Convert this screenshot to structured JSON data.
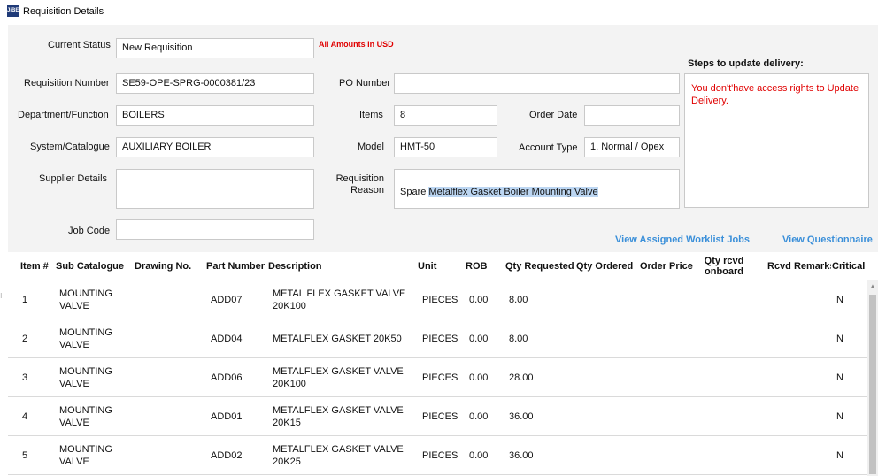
{
  "window": {
    "title": "Requisition Details",
    "icon_label": "JiBE"
  },
  "labels": {
    "current_status": "Current Status",
    "requisition_number": "Requisition Number",
    "department": "Department/Function",
    "system": "System/Catalogue",
    "supplier": "Supplier Details",
    "job_code": "Job Code",
    "po_number": "PO Number",
    "items": "Items",
    "model": "Model",
    "reason_line1": "Requisition",
    "reason_line2": "Reason",
    "order_date": "Order Date",
    "account_type": "Account Type"
  },
  "values": {
    "current_status": "New Requisition",
    "requisition_number": "SE59-OPE-SPRG-0000381/23",
    "department": "BOILERS",
    "system": "AUXILIARY BOILER",
    "supplier": "",
    "job_code": "",
    "po_number": "",
    "items": "8",
    "model": "HMT-50",
    "reason_prefix": "Spare ",
    "reason_highlight": "Metalflex Gasket Boiler Mounting Valve",
    "order_date": "",
    "account_type": "1. Normal / Opex"
  },
  "amounts_note": "All Amounts in USD",
  "steps": {
    "title": "Steps to update delivery:",
    "message": "You don't'have access rights to Update Delivery."
  },
  "links": {
    "worklist": "View Assigned Worklist Jobs",
    "questionnaire": "View Questionnaire"
  },
  "table": {
    "headers": {
      "item": "Item #",
      "sub_catalogue": "Sub Catalogue",
      "drawing": "Drawing No.",
      "part": "Part Number",
      "description": "Description",
      "unit": "Unit",
      "rob": "ROB",
      "qty_requested": "Qty Requested",
      "qty_ordered": "Qty Ordered",
      "order_price": "Order Price",
      "qty_rcvd_1": "Qty rcvd",
      "qty_rcvd_2": "onboard",
      "rcvd_remarks": "Rcvd Remarks",
      "critical": "Critical"
    },
    "rows": [
      {
        "item": "1",
        "sub1": "MOUNTING",
        "sub2": "VALVE",
        "drawing": "",
        "part": "ADD07",
        "desc1": "METAL FLEX GASKET VALVE",
        "desc2": "20K100",
        "unit": "PIECES",
        "rob": "0.00",
        "qty_requested": "8.00",
        "qty_ordered": "",
        "order_price": "",
        "qty_rcvd": "",
        "remarks": "",
        "critical": "N"
      },
      {
        "item": "2",
        "sub1": "MOUNTING",
        "sub2": "VALVE",
        "drawing": "",
        "part": "ADD04",
        "desc1": "METALFLEX GASKET 20K50",
        "desc2": "",
        "unit": "PIECES",
        "rob": "0.00",
        "qty_requested": "8.00",
        "qty_ordered": "",
        "order_price": "",
        "qty_rcvd": "",
        "remarks": "",
        "critical": "N"
      },
      {
        "item": "3",
        "sub1": "MOUNTING",
        "sub2": "VALVE",
        "drawing": "",
        "part": "ADD06",
        "desc1": "METALFLEX GASKET VALVE",
        "desc2": "20K100",
        "unit": "PIECES",
        "rob": "0.00",
        "qty_requested": "28.00",
        "qty_ordered": "",
        "order_price": "",
        "qty_rcvd": "",
        "remarks": "",
        "critical": "N"
      },
      {
        "item": "4",
        "sub1": "MOUNTING",
        "sub2": "VALVE",
        "drawing": "",
        "part": "ADD01",
        "desc1": "METALFLEX GASKET VALVE",
        "desc2": "20K15",
        "unit": "PIECES",
        "rob": "0.00",
        "qty_requested": "36.00",
        "qty_ordered": "",
        "order_price": "",
        "qty_rcvd": "",
        "remarks": "",
        "critical": "N"
      },
      {
        "item": "5",
        "sub1": "MOUNTING",
        "sub2": "VALVE",
        "drawing": "",
        "part": "ADD02",
        "desc1": "METALFLEX GASKET VALVE",
        "desc2": "20K25",
        "unit": "PIECES",
        "rob": "0.00",
        "qty_requested": "36.00",
        "qty_ordered": "",
        "order_price": "",
        "qty_rcvd": "",
        "remarks": "",
        "critical": "N"
      }
    ]
  }
}
